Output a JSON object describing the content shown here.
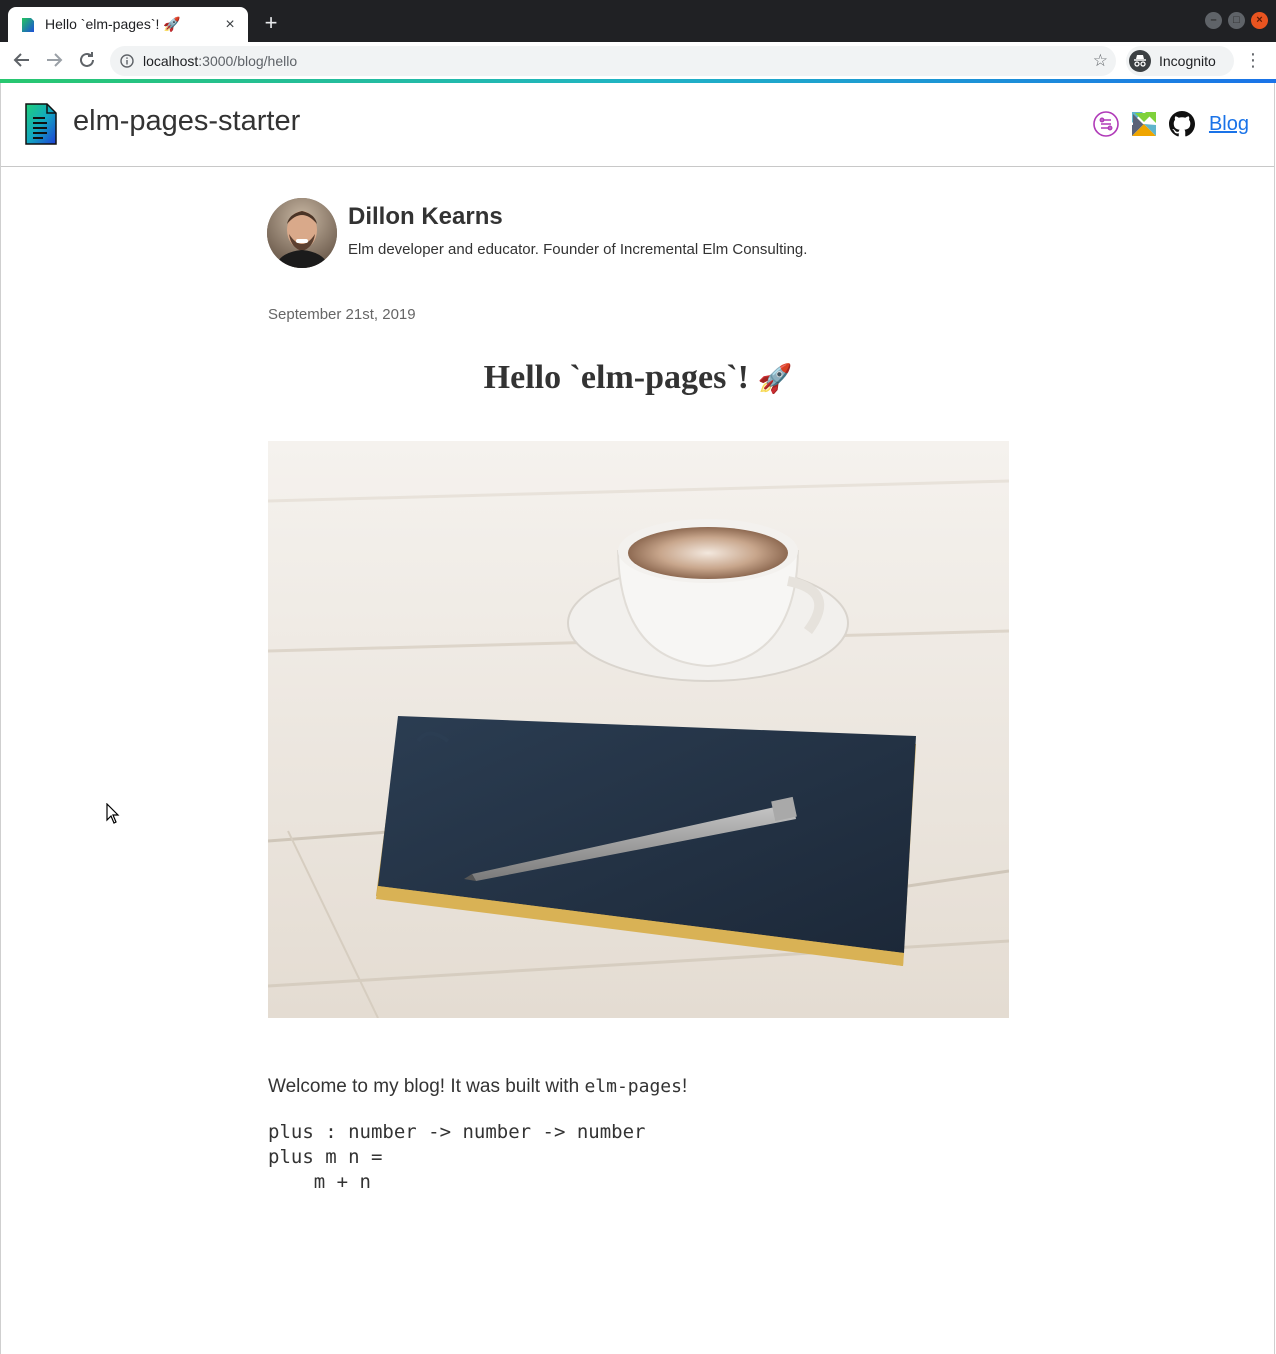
{
  "browser": {
    "tab_title": "Hello `elm-pages`! 🚀",
    "new_tab_symbol": "+",
    "close_symbol": "×",
    "url_host": "localhost",
    "url_path": ":3000/blog/hello",
    "incognito_label": "Incognito"
  },
  "header": {
    "site_title": "elm-pages-starter",
    "nav_link": "Blog",
    "icons": [
      "elm-pages-icon",
      "elm-logo-icon",
      "github-icon"
    ]
  },
  "author": {
    "name": "Dillon Kearns",
    "bio": "Elm developer and educator. Founder of Incremental Elm Consulting."
  },
  "post": {
    "date": "September 21st, 2019",
    "title": "Hello `elm-pages`!",
    "title_emoji": "🚀",
    "intro_before": "Welcome to my blog! It was built with ",
    "intro_code": "elm-pages",
    "intro_after": "!",
    "code_lines": [
      "plus : number -> number -> number",
      "plus m n =",
      "    m + n"
    ]
  },
  "colors": {
    "link": "#1a73e8",
    "text": "#333333",
    "chrome_dark": "#202124"
  }
}
